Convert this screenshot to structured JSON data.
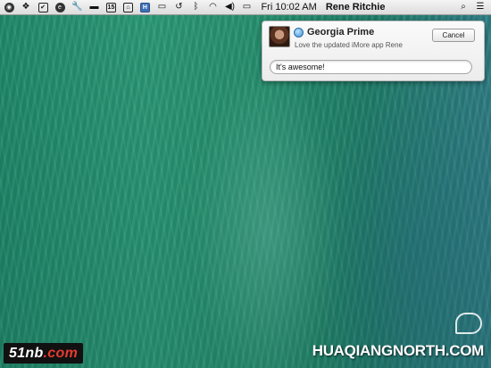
{
  "menubar": {
    "icons": [
      {
        "name": "eye-icon",
        "glyph": "◉"
      },
      {
        "name": "dropbox-icon",
        "glyph": "❖"
      },
      {
        "name": "checkbox-icon",
        "glyph": "✔"
      },
      {
        "name": "e-circle-icon",
        "glyph": "e"
      },
      {
        "name": "wrench-icon",
        "glyph": "🔧"
      },
      {
        "name": "chat-icon",
        "glyph": "▬"
      },
      {
        "name": "calendar-icon",
        "glyph": "15"
      },
      {
        "name": "home-icon",
        "glyph": "⌂"
      },
      {
        "name": "h-app-icon",
        "glyph": "H"
      },
      {
        "name": "airplay-icon",
        "glyph": "▭"
      },
      {
        "name": "time-machine-icon",
        "glyph": "↺"
      },
      {
        "name": "bluetooth-icon",
        "glyph": "ᛒ"
      },
      {
        "name": "wifi-icon",
        "glyph": "◠"
      },
      {
        "name": "volume-icon",
        "glyph": "◀)"
      },
      {
        "name": "battery-icon",
        "glyph": "▭"
      }
    ],
    "clock": "Fri 10:02 AM",
    "user": "Rene Ritchie",
    "search_glyph": "⌕",
    "list_glyph": "☰"
  },
  "notification": {
    "sender": "Georgia Prime",
    "message": "Love the updated iMore app Rene",
    "cancel_label": "Cancel",
    "reply_value": "It's awesome!"
  },
  "watermarks": {
    "left_prefix": "51nb",
    "left_suffix": ".com",
    "right": "HUAQIANGNORTH.COM"
  }
}
